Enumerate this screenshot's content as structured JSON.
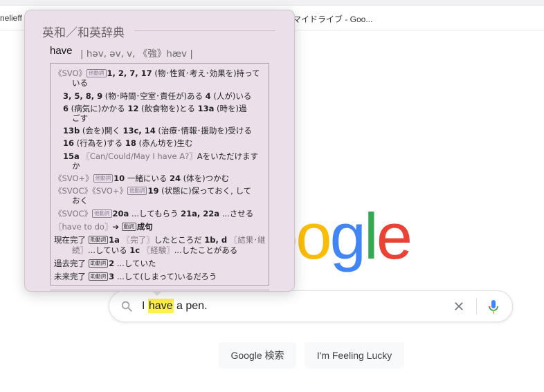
{
  "browser": {
    "bookmark_left": "nelieff",
    "bookmark_right": "マイドライブ - Goo..."
  },
  "logo": {
    "letters": [
      {
        "ch": "o",
        "color": "#ea4335"
      },
      {
        "ch": "o",
        "color": "#fbbc05"
      },
      {
        "ch": "g",
        "color": "#4285f4"
      },
      {
        "ch": "l",
        "color": "#34a853"
      },
      {
        "ch": "e",
        "color": "#ea4335"
      }
    ]
  },
  "search": {
    "pre": "I ",
    "highlight": "have",
    "post": " a pen.",
    "icons": [
      "search-icon",
      "clear-icon",
      "mic-icon"
    ]
  },
  "buttons": {
    "search": "Google 検索",
    "lucky": "I'm Feeling Lucky"
  },
  "popup": {
    "title": "英和／和英辞典",
    "headword": "have",
    "pronunciation": "| həv, əv, v, 《強》hæv |",
    "tag_verb": "他動詞",
    "tag_aux": "助動詞",
    "tag_doshi": "動詞",
    "lines": [
      {
        "g": "《SVO》",
        "t": "他動詞",
        "b": "1, 2, 7, 17",
        "r": " (物･性質･考え･効果を)持って"
      },
      {
        "r": "いる"
      },
      {
        "b": "3, 5, 8, 9",
        "r": " (物･時間･空室･責任が)ある ",
        "b2": "4",
        "r2": " (人が)いる"
      },
      {
        "b": "6",
        "r": " (病気に)かかる ",
        "b2": "12",
        "r2": " (飲食物を)とる ",
        "b3": "13a",
        "r3": " (時を)過"
      },
      {
        "r": "ごす"
      },
      {
        "b": "13b",
        "r": " (会を)開く ",
        "b2": "13c, 14",
        "r2": " (治療･情報･援助を)受ける"
      },
      {
        "b": "16",
        "r": " (行為を)する ",
        "b2": "18",
        "r2": " (赤ん坊を)生む"
      },
      {
        "b": "15a",
        "g": " 〖Can/Could/May I have A?〗",
        "r": "Aをいただけます"
      },
      {
        "r": "か"
      },
      {
        "g": "《SVO+》",
        "t": "他動詞",
        "b": "10",
        "r": " 一緒にいる ",
        "b2": "24",
        "r2": " (体を)つかむ"
      },
      {
        "g": "《SVOC》《SVO+》",
        "t": "他動詞",
        "b": "19",
        "r": " (状態に)保っておく, して"
      },
      {
        "r": "おく"
      },
      {
        "g": "《SVOC》",
        "t": "他動詞",
        "b": "20a",
        "r": " ...してもらう ",
        "b2": "21a, 22a",
        "r2": " ...させる"
      },
      {
        "g": "〖have to do〗",
        "r": "➔ ",
        "t": "動詞",
        "b": "成句"
      },
      {
        "r": "現在完了 ",
        "t": "助動詞",
        "b": "1a",
        "g": " 〖完了〗",
        "r2": "したところだ ",
        "b2": "1b, d",
        "g2": " 〖結果･継"
      },
      {
        "g": "続〗",
        "r": "...している ",
        "b": "1c",
        "g2": " 〖経験〗",
        "r2": "...したことがある"
      },
      {
        "r": "過去完了 ",
        "t": "助動詞",
        "b": "2",
        "r2": " ...していた"
      },
      {
        "r": "未来完了 ",
        "t": "助動詞",
        "b": "3",
        "r2": " ...して(しまって)いるだろう"
      }
    ]
  }
}
